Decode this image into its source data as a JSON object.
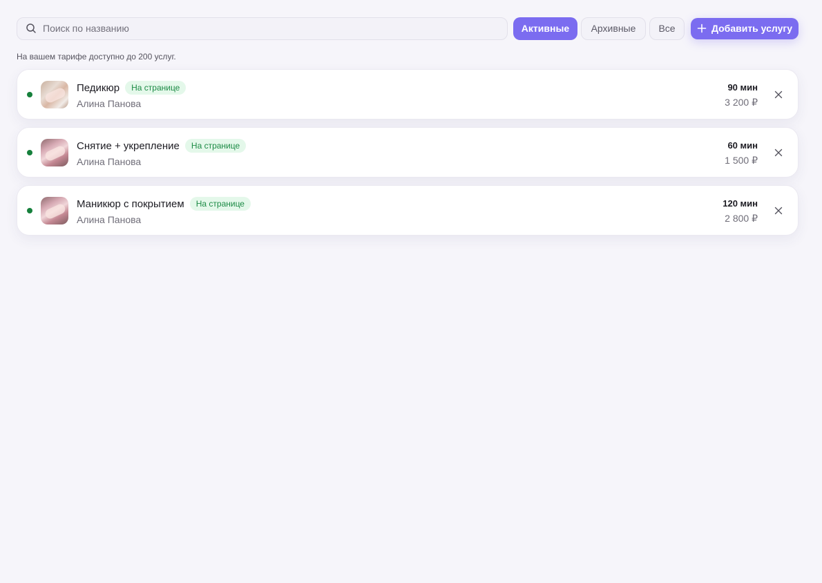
{
  "search": {
    "placeholder": "Поиск по названию",
    "value": ""
  },
  "filters": {
    "active": "Активные",
    "archive": "Архивные",
    "all": "Все",
    "selected": "Активные"
  },
  "add_button": {
    "label": "Добавить услугу"
  },
  "tariff_note": "На вашем тарифе доступно до 200 услуг.",
  "services": [
    {
      "title": "Педикюр",
      "badge": "На странице",
      "master": "Алина Панова",
      "duration": "90 мин",
      "price": "3 200 ₽"
    },
    {
      "title": "Снятие + укрепление",
      "badge": "На странице",
      "master": "Алина Панова",
      "duration": "60 мин",
      "price": "1 500 ₽"
    },
    {
      "title": "Маникюр с покрытием",
      "badge": "На странице",
      "master": "Алина Панова",
      "duration": "120 мин",
      "price": "2 800 ₽"
    }
  ],
  "colors": {
    "accent": "#7b6cf0",
    "status_active": "#16803c",
    "badge_bg": "#e4f8ea",
    "badge_text": "#1b8a44",
    "page_bg": "#f6f5fa"
  },
  "icons": {
    "search": "search-icon",
    "add": "plus-icon",
    "remove": "close-icon"
  }
}
